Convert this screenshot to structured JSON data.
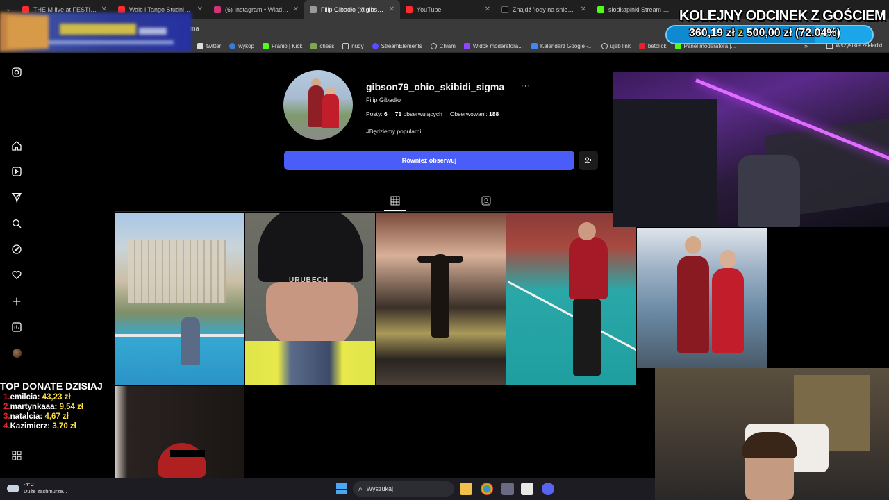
{
  "browser": {
    "tabs": [
      {
        "title": "THE M live at FESTIVALAN",
        "color": "#ff2a2a",
        "active": false
      },
      {
        "title": "Walc i Tango Studniówka",
        "color": "#ff2a2a",
        "active": false
      },
      {
        "title": "(6) Instagram • Wiadomo",
        "color": "#d6307a",
        "active": false
      },
      {
        "title": "Filip Gibadło (@gibson79",
        "color": "#9a9a9a",
        "active": true
      },
      {
        "title": "YouTube",
        "color": "#ff2a2a",
        "active": false
      },
      {
        "title": "Znajdź 'lody na śniegu' n",
        "color": "#111111",
        "active": false
      },
      {
        "title": "slodkapinki Stream - Wat",
        "color": "#53fc18",
        "active": false
      }
    ],
    "address_fragment": "ma",
    "bookmarks": [
      {
        "label": "twitter",
        "color": "#ffffff"
      },
      {
        "label": "wykop",
        "color": "#3a7bd5"
      },
      {
        "label": "Franio | Kick",
        "color": "#53fc18"
      },
      {
        "label": "chess",
        "color": "#7fa650"
      },
      {
        "label": "nudy",
        "color": "#cccccc"
      },
      {
        "label": "StreamElements",
        "color": "#5a4cff"
      },
      {
        "label": "Chłam",
        "color": "#cccccc"
      },
      {
        "label": "Widok moderatora...",
        "color": "#9146ff"
      },
      {
        "label": "Kalendarz Google -...",
        "color": "#4285f4"
      },
      {
        "label": "ujeb link",
        "color": "#cccccc"
      },
      {
        "label": "betclick",
        "color": "#e8202a"
      },
      {
        "label": "Panel moderatora |...",
        "color": "#53fc18"
      }
    ],
    "bookmarks_more": "»",
    "all_bookmarks": "Wszystkie zakładki"
  },
  "profile": {
    "username": "gibson79_ohio_skibidi_sigma",
    "more": "···",
    "full_name": "Filip Gibadło",
    "posts_label": "Posty:",
    "posts_count": "6",
    "followers_count": "71",
    "followers_label": "obserwujących",
    "following_label": "Obserwowani:",
    "following_count": "188",
    "bio": "#Będziemy popularni",
    "follow_button": "Również obserwuj"
  },
  "stream": {
    "goal_title": "KOLEJNY ODCINEK Z GOŚCIEM",
    "goal_current": "360,19 zł",
    "goal_sep": "z",
    "goal_target": "500,00 zł",
    "goal_percent_text": "(72.04%)",
    "goal_progress": 0.7204,
    "donates_title": "TOP DONATE DZISIAJ",
    "donates": [
      {
        "rank": "1.",
        "name": "emilcia:",
        "amount": "43,23 zł"
      },
      {
        "rank": "2.",
        "name": "martynkaaa:",
        "amount": "9,54 zł"
      },
      {
        "rank": "3.",
        "name": "natalcia:",
        "amount": "4,67 zł"
      },
      {
        "rank": "4.",
        "name": "Kazimierz:",
        "amount": "3,70 zł"
      }
    ]
  },
  "taskbar": {
    "weather_temp": "-4°C",
    "weather_desc": "Duże zachmurze...",
    "search_placeholder": "Wyszukaj"
  }
}
